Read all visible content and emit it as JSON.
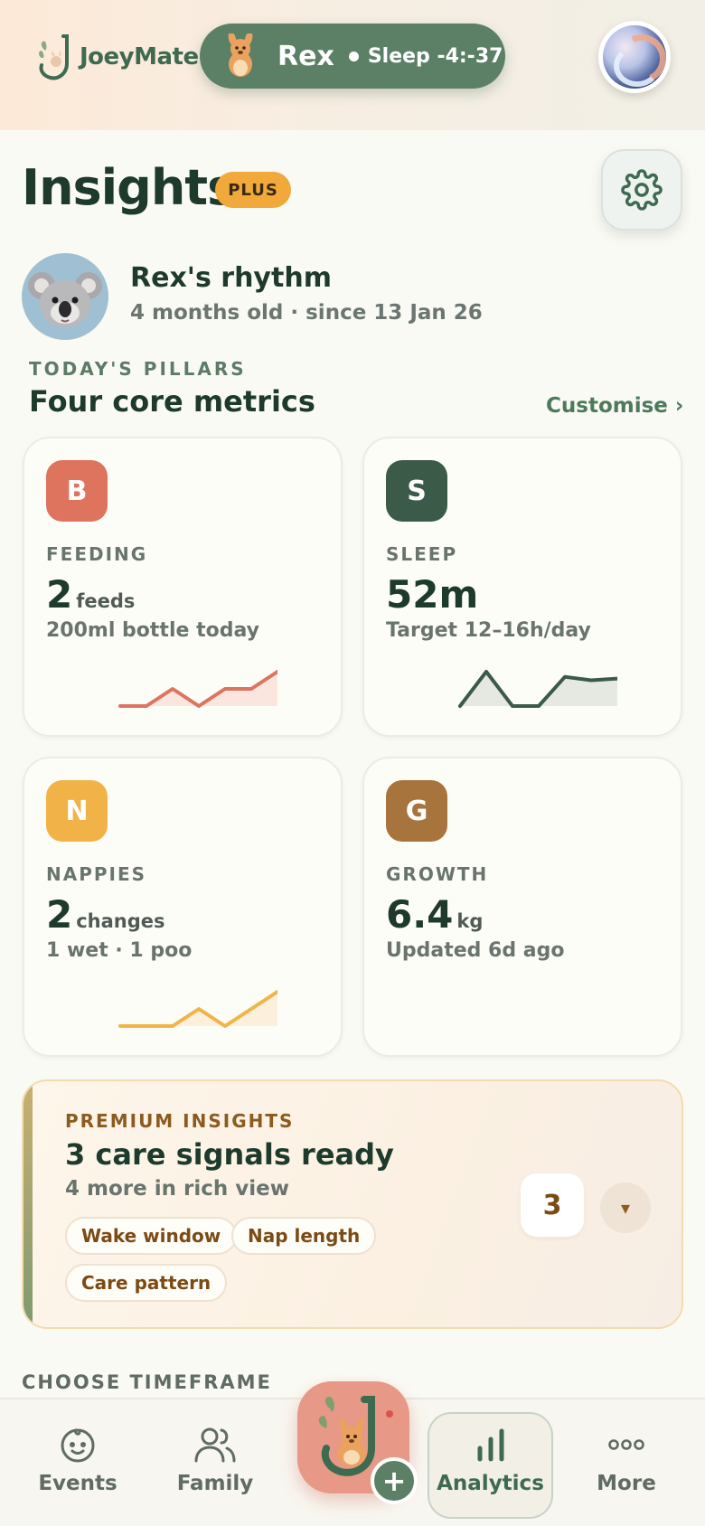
{
  "header": {
    "logo_text": "JoeyMate",
    "baby_name": "Rex",
    "baby_status": "Sleep -4:-37"
  },
  "page": {
    "title": "Insights",
    "badge": "PLUS"
  },
  "profile": {
    "title": "Rex's rhythm",
    "subtitle": "4 months old · since 13 Jan 26"
  },
  "pillars": {
    "section_label": "TODAY'S PILLARS",
    "heading": "Four core metrics",
    "customise": "Customise ›",
    "cards": [
      {
        "letter": "B",
        "label": "FEEDING",
        "value": "2",
        "unit": "feeds",
        "sub": "200ml bottle today",
        "color": "#de735e",
        "line": "#db7560",
        "fill": "#fbe6df",
        "spark": [
          0,
          0,
          1,
          0,
          1,
          1,
          2
        ]
      },
      {
        "letter": "S",
        "label": "SLEEP",
        "value": "52m",
        "unit": "",
        "sub": "Target 12–16h/day",
        "color": "#3b5a48",
        "line": "#3b5a48",
        "fill": "#e5e9e2",
        "spark": [
          0,
          2,
          0,
          0,
          1.7,
          1.5,
          1.6
        ]
      },
      {
        "letter": "N",
        "label": "NAPPIES",
        "value": "2",
        "unit": "changes",
        "sub": "1 wet · 1 poo",
        "color": "#f1b347",
        "line": "#f0b447",
        "fill": "#fcf0dc",
        "spark": [
          0,
          0,
          0,
          1,
          0,
          1,
          2
        ]
      },
      {
        "letter": "G",
        "label": "GROWTH",
        "value": "6.4",
        "unit": "kg",
        "sub": "Updated 6d ago",
        "color": "#a8743d",
        "line": "",
        "fill": "",
        "spark": []
      }
    ]
  },
  "premium": {
    "label": "PREMIUM INSIGHTS",
    "title": "3 care signals ready",
    "subtitle": "4 more in rich view",
    "chips": [
      "Wake window",
      "Nap length",
      "Care pattern"
    ],
    "count": "3",
    "expand_icon": "▾"
  },
  "timeframe": {
    "label": "CHOOSE TIMEFRAME"
  },
  "nav": {
    "items": [
      {
        "label": "Events",
        "icon": "baby-face-icon"
      },
      {
        "label": "Family",
        "icon": "people-icon"
      },
      {
        "label": "Analytics",
        "icon": "bar-chart-icon"
      },
      {
        "label": "More",
        "icon": "more-dots-icon"
      }
    ],
    "fab_plus": "+"
  }
}
